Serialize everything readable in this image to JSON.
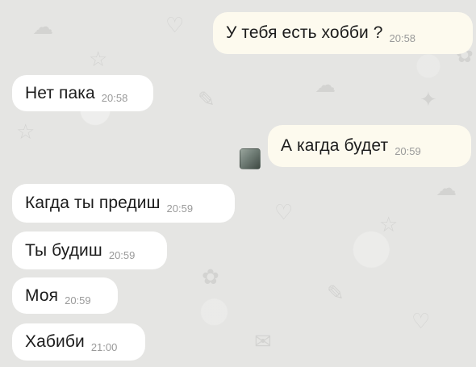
{
  "messages": [
    {
      "side": "out",
      "text": "У тебя есть хобби ?",
      "time": "20:58"
    },
    {
      "side": "in",
      "text": "Нет пака",
      "time": "20:58"
    },
    {
      "side": "out",
      "text": "А кагда будет",
      "time": "20:59"
    },
    {
      "side": "in",
      "text": "Кагда ты предиш",
      "time": "20:59"
    },
    {
      "side": "in",
      "text": "Ты будиш",
      "time": "20:59"
    },
    {
      "side": "in",
      "text": "Моя",
      "time": "20:59"
    },
    {
      "side": "in",
      "text": "Хабиби",
      "time": "21:00"
    }
  ],
  "icons": {
    "status_thumbnail": "seen-thumbnail-icon"
  },
  "colors": {
    "background": "#e5e5e3",
    "incoming_bubble": "#ffffff",
    "outgoing_bubble": "#fdfaee",
    "message_text": "#1c1c1c",
    "time_text": "#9a9a9a"
  }
}
